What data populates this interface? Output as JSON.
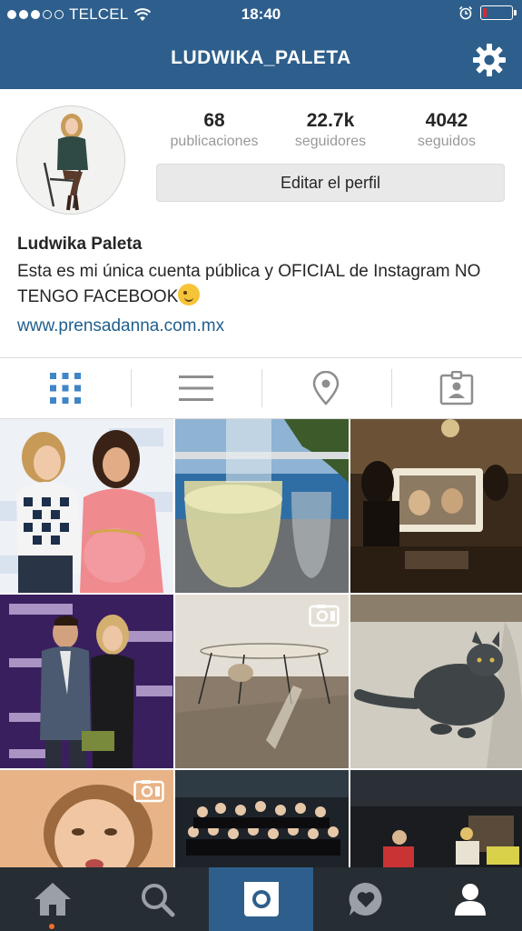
{
  "status_bar": {
    "carrier": "TELCEL",
    "time": "18:40",
    "signal_bars_filled": 3,
    "signal_bars_total": 5,
    "battery_level": 0.12,
    "battery_color": "#e0262a"
  },
  "nav": {
    "title": "LUDWIKA_PALETA",
    "settings_icon": "gear-icon"
  },
  "profile": {
    "full_name": "Ludwika Paleta",
    "bio": "Esta es mi única cuenta pública y OFICIAL de Instagram NO TENGO FACEBOOK",
    "bio_emoji": "winking-face-emoji",
    "website": "www.prensadanna.com.mx",
    "edit_button_label": "Editar el perfil",
    "stats": [
      {
        "value": "68",
        "label": "publicaciones"
      },
      {
        "value": "22.7k",
        "label": "seguidores"
      },
      {
        "value": "4042",
        "label": "seguidos"
      }
    ]
  },
  "view_tabs": [
    {
      "icon": "grid-icon",
      "active": true
    },
    {
      "icon": "list-icon",
      "active": false
    },
    {
      "icon": "location-pin-icon",
      "active": false
    },
    {
      "icon": "tagged-photos-icon",
      "active": false
    }
  ],
  "bottom_nav": [
    {
      "icon": "home-icon"
    },
    {
      "icon": "search-icon"
    },
    {
      "icon": "camera-icon"
    },
    {
      "icon": "activity-heart-icon"
    },
    {
      "icon": "profile-icon"
    }
  ],
  "colors": {
    "brand_blue": "#2e5f8c",
    "link_blue": "#1f5e8e",
    "active_tab_blue": "#3f86c6",
    "bottom_bar": "#262d33",
    "notification_dot": "#f26c2b"
  }
}
